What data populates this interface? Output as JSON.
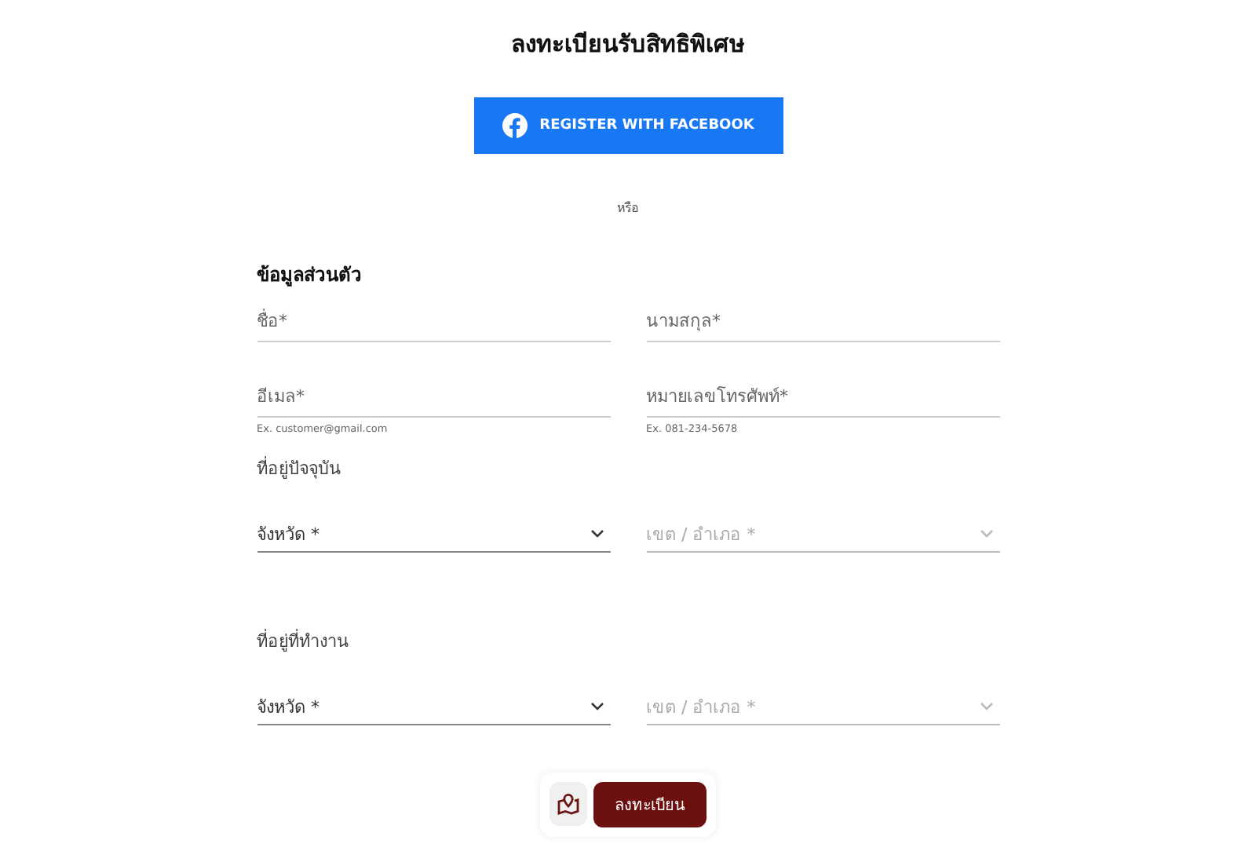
{
  "title": "ลงทะเบียนรับสิทธิพิเศษ",
  "facebook_button": "REGISTER WITH FACEBOOK",
  "divider_text": "หรือ",
  "section_title": "ข้อมูลส่วนตัว",
  "fields": [
    {
      "placeholder": "ชื่อ*"
    },
    {
      "placeholder": "นามสกุล*"
    },
    {
      "placeholder": "อีเมล*",
      "hint": "Ex. customer@gmail.com"
    },
    {
      "placeholder": "หมายเลขโทรศัพท์*",
      "hint": "Ex. 081-234-5678"
    }
  ],
  "addresses": [
    {
      "label": "ที่อยู่ปัจจุบัน",
      "selects": [
        {
          "placeholder": "จังหวัด *",
          "disabled": false
        },
        {
          "placeholder": "เขต / อำเภอ *",
          "disabled": true
        }
      ]
    },
    {
      "label": "ที่อยู่ที่ทำงาน",
      "selects": [
        {
          "placeholder": "จังหวัด *",
          "disabled": false
        },
        {
          "placeholder": "เขต / อำเภอ *",
          "disabled": true
        }
      ]
    }
  ],
  "submit_button": "ลงทะเบียน"
}
